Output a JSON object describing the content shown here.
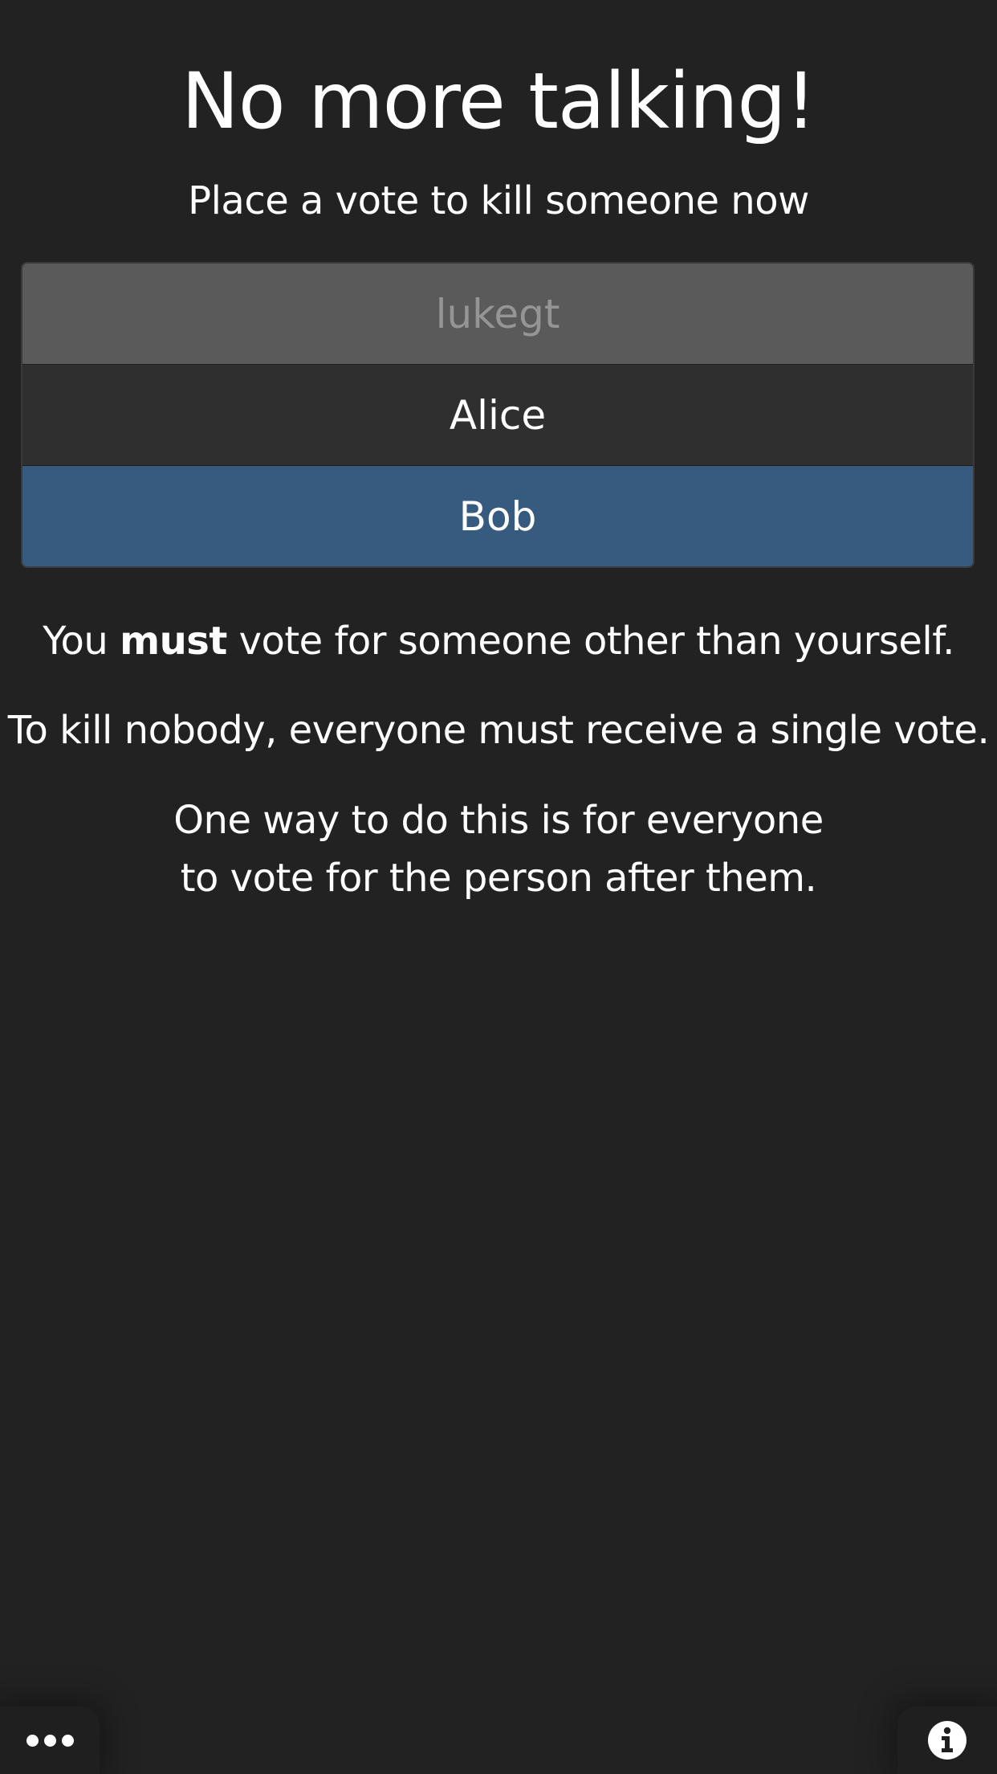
{
  "header": {
    "title": "No more talking!",
    "subtitle": "Place a vote to kill someone now"
  },
  "vote": {
    "options": [
      {
        "label": "lukegt",
        "state": "disabled"
      },
      {
        "label": "Alice",
        "state": "normal"
      },
      {
        "label": "Bob",
        "state": "selected"
      }
    ]
  },
  "rules": {
    "rule1_prefix": "You ",
    "rule1_emphasis": "must",
    "rule1_suffix": " vote for someone other than yourself.",
    "rule2": "To kill nobody, everyone must receive a single vote.",
    "rule3_line1": "One way to do this is for everyone",
    "rule3_line2": "to vote for the person after them."
  },
  "footer": {
    "menu_icon": "ellipsis-icon",
    "info_icon": "info-circle-icon"
  },
  "colors": {
    "background": "#222222",
    "selected": "#375a7f",
    "option": "#2f2f2f",
    "disabled": "#5a5a5a"
  }
}
